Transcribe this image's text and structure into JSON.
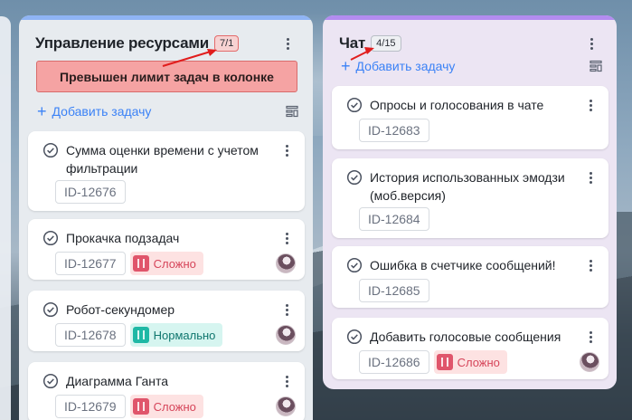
{
  "board": {
    "columns": [
      {
        "title": "Управление ресурсами",
        "count_badge": "7/1",
        "limit_warning": "Превышен лимит задач в колонке",
        "add_task": "Добавить задачу",
        "cards": [
          {
            "title": "Сумма оценки времени с учетом фильтрации",
            "id": "ID-12676"
          },
          {
            "title": "Прокачка подзадач",
            "id": "ID-12677",
            "tag": "Сложно",
            "tag_level": "hard"
          },
          {
            "title": "Робот-секундомер",
            "id": "ID-12678",
            "tag": "Нормально",
            "tag_level": "normal"
          },
          {
            "title": "Диаграмма Ганта",
            "id": "ID-12679",
            "tag": "Сложно",
            "tag_level": "hard"
          }
        ]
      },
      {
        "title": "Чат",
        "count_badge": "4/15",
        "add_task": "Добавить задачу",
        "cards": [
          {
            "title": "Опросы и голосования в чате",
            "id": "ID-12683"
          },
          {
            "title": "История использованных эмодзи (моб.версия)",
            "id": "ID-12684"
          },
          {
            "title": "Ошибка в счетчике сообщений!",
            "id": "ID-12685"
          },
          {
            "title": "Добавить голосовые сообщения",
            "id": "ID-12686",
            "tag": "Сложно",
            "tag_level": "hard"
          }
        ]
      }
    ]
  },
  "icons": {
    "check": "check-circle-icon",
    "menu": "kebab-menu-icon",
    "filter": "filter-icon",
    "tag": "film-icon",
    "add": "plus-icon"
  },
  "colors": {
    "accent": "#3b82f6",
    "over_limit_bg": "#f5a3a3",
    "hard_tag": "#e0556b",
    "normal_tag": "#1fb8a5",
    "annotation_arrow": "#e11d1d"
  }
}
